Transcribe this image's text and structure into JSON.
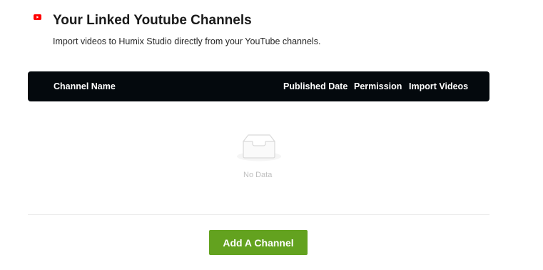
{
  "header": {
    "icon": "youtube-icon",
    "title": "Your Linked Youtube Channels",
    "subtitle": "Import videos to Humix Studio directly from your YouTube channels."
  },
  "table": {
    "columns": [
      "Channel Name",
      "Published Date",
      "Permission",
      "Import Videos"
    ],
    "rows": [],
    "empty_icon": "empty-inbox-icon",
    "empty_text": "No Data"
  },
  "actions": {
    "add_channel_label": "Add A Channel"
  },
  "colors": {
    "header_bg": "#04090d",
    "button_bg": "#63a21f",
    "youtube_red": "#ff0000"
  }
}
